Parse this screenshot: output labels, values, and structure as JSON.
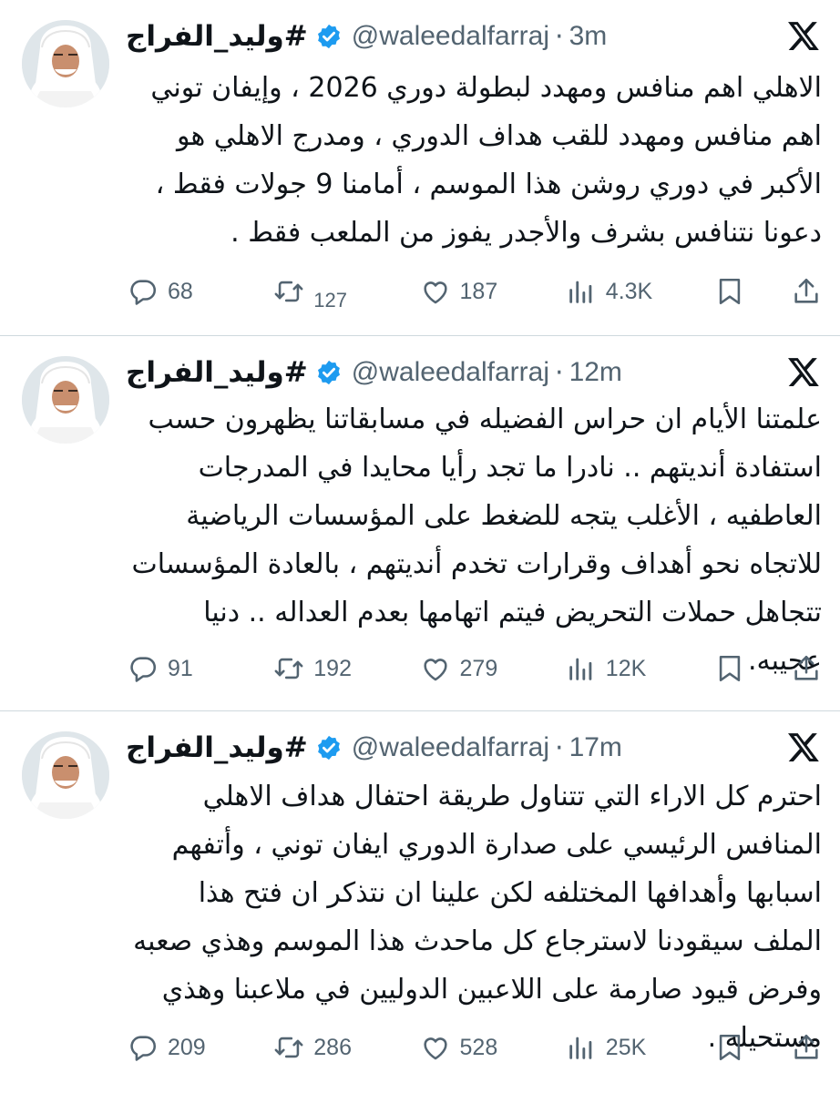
{
  "tweets": [
    {
      "display_name": "#وليد_الفراج",
      "handle": "@waleedalfarraj",
      "time": "3m",
      "text": "الاهلي اهم منافس ومهدد لبطولة دوري 2026 ، وإيفان توني اهم منافس ومهدد للقب هداف الدوري ، ومدرج الاهلي هو الأكبر في دوري روشن هذا الموسم ، أمامنا 9 جولات فقط ، دعونا نتنافس بشرف والأجدر يفوز من الملعب فقط .",
      "replies": "68",
      "reposts": "127",
      "likes": "187",
      "views": "4.3K"
    },
    {
      "display_name": "#وليد_الفراج",
      "handle": "@waleedalfarraj",
      "time": "12m",
      "text": "علمتنا الأيام ان حراس الفضيله في مسابقاتنا يظهرون حسب استفادة أنديتهم .. نادرا ما تجد رأيا محايدا في المدرجات العاطفيه ، الأغلب يتجه للضغط على المؤسسات الرياضية للاتجاه نحو أهداف وقرارات تخدم أنديتهم ، بالعادة المؤسسات تتجاهل حملات التحريض فيتم اتهامها بعدم العداله .. دنيا عجيبه.",
      "replies": "91",
      "reposts": "192",
      "likes": "279",
      "views": "12K"
    },
    {
      "display_name": "#وليد_الفراج",
      "handle": "@waleedalfarraj",
      "time": "17m",
      "text": "احترم كل الاراء التي تتناول طريقة احتفال هداف الاهلي المنافس الرئيسي على صدارة الدوري ايفان توني ، وأتفهم اسبابها وأهدافها المختلفه لكن علينا ان نتذكر ان فتح هذا الملف سيقودنا لاسترجاع كل ماحدث هذا الموسم وهذي صعبه وفرض قيود صارمة على اللاعبين الدوليين في ملاعبنا وهذي مستحيله .",
      "replies": "209",
      "reposts": "286",
      "likes": "528",
      "views": "25K"
    }
  ],
  "colors": {
    "verified": "#1d9bf0",
    "muted": "#536471",
    "text": "#0f1419",
    "separator": "#cfd9de"
  },
  "icons": [
    "verified-badge-icon",
    "x-logo-icon",
    "reply-icon",
    "repost-icon",
    "like-icon",
    "views-icon",
    "bookmark-icon",
    "share-icon"
  ]
}
